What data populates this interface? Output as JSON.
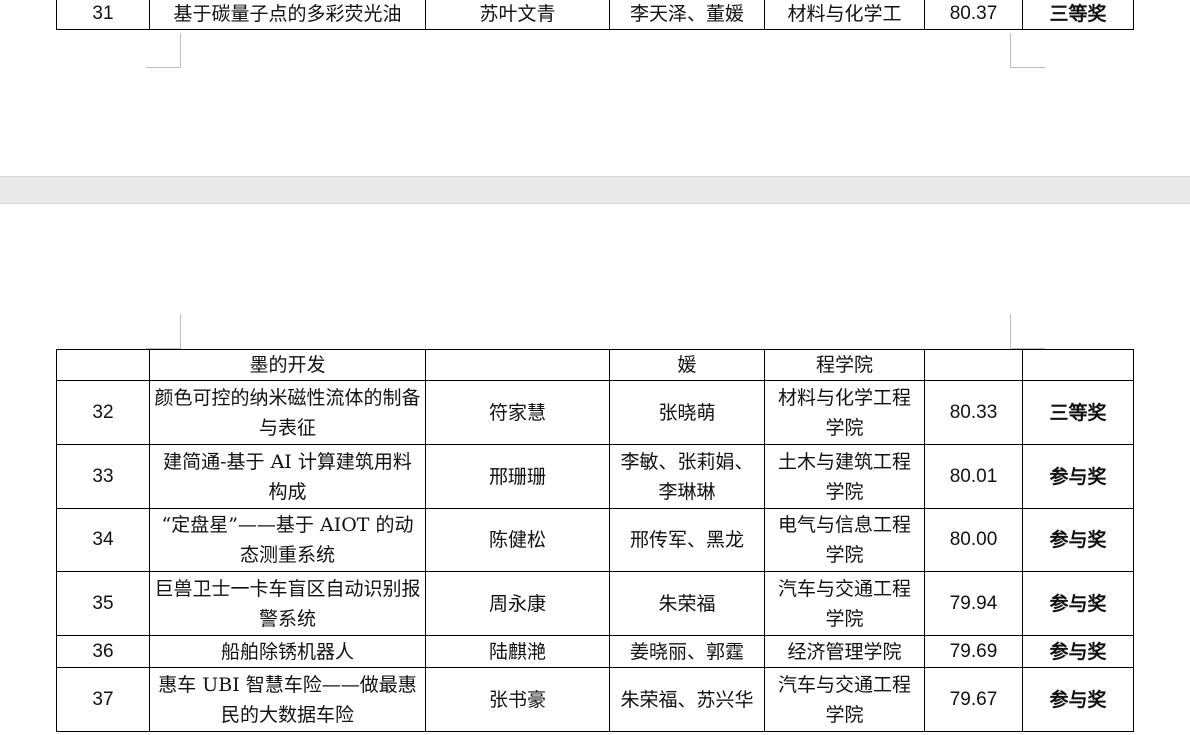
{
  "rows_top": [
    {
      "no": "31",
      "title": "基于碳量子点的多彩荧光油",
      "leader": "苏叶文青",
      "members": "李天泽、董媛",
      "college": "材料与化学工",
      "score": "80.37",
      "award": "三等奖"
    }
  ],
  "row_continued": {
    "no": "",
    "title": "墨的开发",
    "leader": "",
    "members": "媛",
    "college": "程学院",
    "score": "",
    "award": ""
  },
  "rows_bottom": [
    {
      "no": "32",
      "title": "颜色可控的纳米磁性流体的制备与表征",
      "leader": "符家慧",
      "members": "张晓萌",
      "college": "材料与化学工程学院",
      "score": "80.33",
      "award": "三等奖"
    },
    {
      "no": "33",
      "title": "建简通-基于 AI 计算建筑用料构成",
      "leader": "邢珊珊",
      "members": "李敏、张莉娟、李琳琳",
      "college": "土木与建筑工程学院",
      "score": "80.01",
      "award": "参与奖"
    },
    {
      "no": "34",
      "title": "“定盘星”——基于 AIOT 的动态测重系统",
      "leader": "陈健松",
      "members": "邢传军、黑龙",
      "college": "电气与信息工程学院",
      "score": "80.00",
      "award": "参与奖"
    },
    {
      "no": "35",
      "title": "巨兽卫士一卡车盲区自动识别报警系统",
      "leader": "周永康",
      "members": "朱荣福",
      "college": "汽车与交通工程学院",
      "score": "79.94",
      "award": "参与奖"
    },
    {
      "no": "36",
      "title": "船舶除锈机器人",
      "leader": "陆麒滟",
      "members": "姜晓丽、郭霆",
      "college": "经济管理学院",
      "score": "79.69",
      "award": "参与奖"
    },
    {
      "no": "37",
      "title": "惠车 UBI 智慧车险——做最惠民的大数据车险",
      "leader": "张书豪",
      "members": "朱荣福、苏兴华",
      "college": "汽车与交通工程学院",
      "score": "79.67",
      "award": "参与奖"
    }
  ]
}
